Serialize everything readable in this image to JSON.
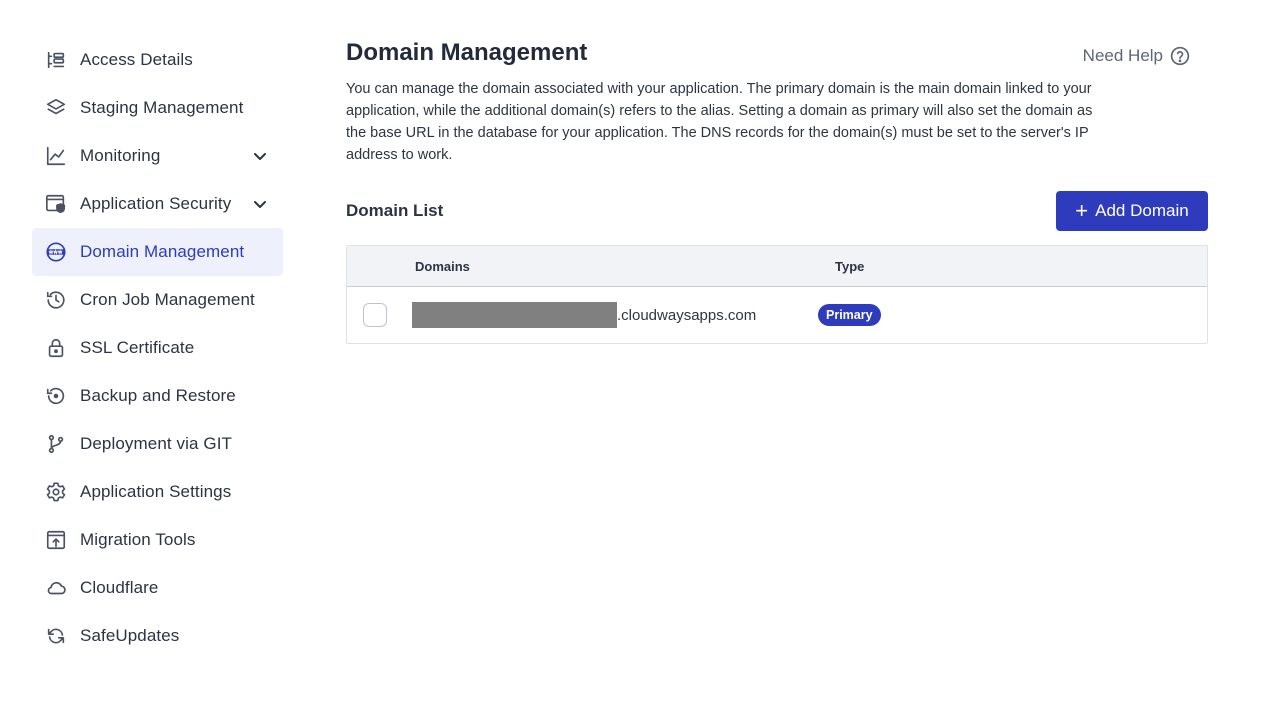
{
  "sidebar": {
    "items": [
      {
        "label": "Access Details",
        "icon": "access-details-icon"
      },
      {
        "label": "Staging Management",
        "icon": "layers-icon"
      },
      {
        "label": "Monitoring",
        "icon": "chart-icon",
        "expandable": true
      },
      {
        "label": "Application Security",
        "icon": "shield-browser-icon",
        "expandable": true
      },
      {
        "label": "Domain Management",
        "icon": "www-icon",
        "active": true
      },
      {
        "label": "Cron Job Management",
        "icon": "history-clock-icon"
      },
      {
        "label": "SSL Certificate",
        "icon": "lock-icon"
      },
      {
        "label": "Backup and Restore",
        "icon": "restore-icon"
      },
      {
        "label": "Deployment via GIT",
        "icon": "git-branch-icon"
      },
      {
        "label": "Application Settings",
        "icon": "gear-icon"
      },
      {
        "label": "Migration Tools",
        "icon": "upload-box-icon"
      },
      {
        "label": "Cloudflare",
        "icon": "cloud-icon"
      },
      {
        "label": "SafeUpdates",
        "icon": "refresh-icon"
      }
    ]
  },
  "main": {
    "title": "Domain Management",
    "need_help": "Need Help",
    "description": "You can manage the domain associated with your application. The primary domain is the main domain linked to your application, while the additional domain(s) refers to the alias. Setting a domain as primary will also set the domain as the base URL in the database for your application. The DNS records for the domain(s) must be set to the server's IP address to work.",
    "domain_list_title": "Domain List",
    "add_domain_label": "Add Domain",
    "table": {
      "columns": [
        "Domains",
        "Type"
      ],
      "rows": [
        {
          "domain_suffix": ".cloudwaysapps.com",
          "type": "Primary"
        }
      ]
    }
  },
  "colors": {
    "accent": "#2f3bbd",
    "active_bg": "#eef0fb",
    "header_bg": "#f1f3f7",
    "redaction": "#808080"
  }
}
